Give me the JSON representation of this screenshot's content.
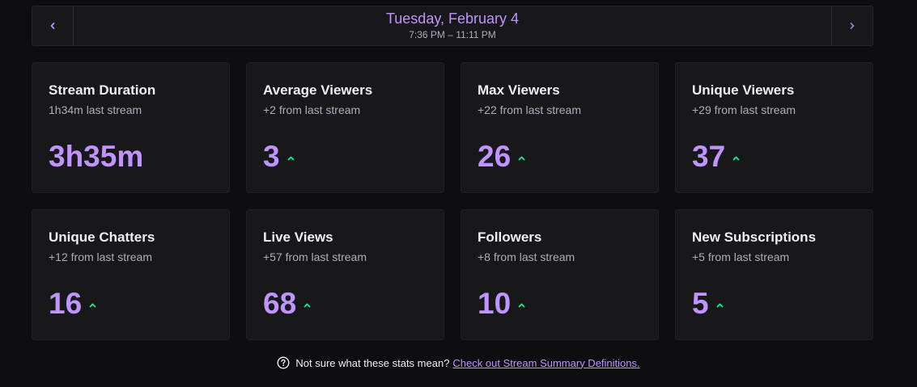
{
  "date_nav": {
    "prev_icon": "chevron-left-icon",
    "next_icon": "chevron-right-icon",
    "title": "Tuesday, February 4",
    "range": "7:36 PM – 11:11 PM"
  },
  "colors": {
    "accent": "#bf94ff",
    "up": "#00f593",
    "card_bg": "#18181b",
    "page_bg": "#0e0e10"
  },
  "stats": [
    {
      "title": "Stream Duration",
      "sub": "1h34m last stream",
      "value": "3h35m",
      "trend": "none"
    },
    {
      "title": "Average Viewers",
      "sub": "+2 from last stream",
      "value": "3",
      "trend": "up"
    },
    {
      "title": "Max Viewers",
      "sub": "+22 from last stream",
      "value": "26",
      "trend": "up"
    },
    {
      "title": "Unique Viewers",
      "sub": "+29 from last stream",
      "value": "37",
      "trend": "up"
    },
    {
      "title": "Unique Chatters",
      "sub": "+12 from last stream",
      "value": "16",
      "trend": "up"
    },
    {
      "title": "Live Views",
      "sub": "+57 from last stream",
      "value": "68",
      "trend": "up"
    },
    {
      "title": "Followers",
      "sub": "+8 from last stream",
      "value": "10",
      "trend": "up"
    },
    {
      "title": "New Subscriptions",
      "sub": "+5 from last stream",
      "value": "5",
      "trend": "up"
    }
  ],
  "footer": {
    "icon": "help-circle-icon",
    "text": "Not sure what these stats mean?",
    "link": "Check out Stream Summary Definitions."
  }
}
